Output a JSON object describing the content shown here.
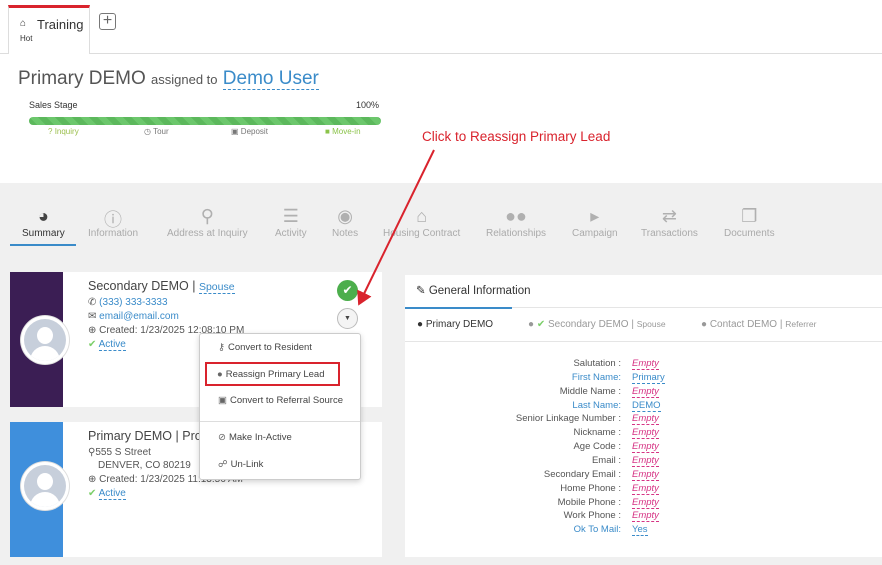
{
  "tabs": {
    "active": {
      "title": "Training",
      "subtitle": "Hot"
    },
    "add_label": "+"
  },
  "header": {
    "record_name": "Primary DEMO",
    "assigned_to_label": "assigned to",
    "assigned_user": "Demo User"
  },
  "sales_stage": {
    "label": "Sales Stage",
    "percent_label": "100%",
    "progress": 1.0,
    "stages": [
      "Inquiry",
      "Tour",
      "Deposit",
      "Move-in"
    ]
  },
  "annotation": {
    "text": "Click to Reassign Primary Lead",
    "color": "#d9232d"
  },
  "nav": {
    "items": [
      {
        "label": "Summary",
        "icon": "dashboard-icon"
      },
      {
        "label": "Information",
        "icon": "info-icon"
      },
      {
        "label": "Address at Inquiry",
        "icon": "map-marker-icon"
      },
      {
        "label": "Activity",
        "icon": "list-icon"
      },
      {
        "label": "Notes",
        "icon": "comments-icon"
      },
      {
        "label": "Housing Contract",
        "icon": "home-icon"
      },
      {
        "label": "Relationships",
        "icon": "users-icon"
      },
      {
        "label": "Campaign",
        "icon": "bullhorn-icon"
      },
      {
        "label": "Transactions",
        "icon": "exchange-icon"
      },
      {
        "label": "Documents",
        "icon": "files-icon"
      }
    ]
  },
  "contacts": [
    {
      "name": "Secondary DEMO",
      "separator": "|",
      "relationship": "Spouse",
      "phone": "(333) 333-3333",
      "email": "email@email.com",
      "created": "Created: 1/23/2025 12:08:10 PM",
      "status": "Active",
      "bar_color": "#3b1e54"
    },
    {
      "name": "Primary DEMO",
      "separator": "|",
      "relationship_partial": "Pro",
      "address_line1": "555 S Street",
      "address_line2": "DENVER, CO 80219",
      "created": "Created: 1/23/2025 11:13:56 AM",
      "status": "Active",
      "bar_color": "#3f8fdc"
    }
  ],
  "dropdown": {
    "items": [
      {
        "label": "Convert to Resident",
        "icon": "key-icon"
      },
      {
        "label": "Reassign Primary Lead",
        "icon": "user-icon"
      },
      {
        "label": "Convert to Referral Source",
        "icon": "id-card-icon"
      },
      {
        "label": "Make In-Active",
        "icon": "ban-icon"
      },
      {
        "label": "Un-Link",
        "icon": "unlink-icon"
      }
    ]
  },
  "general_info": {
    "title": "General Information",
    "tabs": [
      {
        "label": "Primary DEMO",
        "sub": ""
      },
      {
        "label": "Secondary DEMO",
        "sub": "Spouse"
      },
      {
        "label": "Contact DEMO",
        "sub": "Referrer"
      }
    ],
    "tab_separator": "|",
    "fields": [
      {
        "label": "Salutation :",
        "value": "Empty",
        "label_link": false,
        "empty": true
      },
      {
        "label": "First Name:",
        "value": "Primary",
        "label_link": true,
        "empty": false
      },
      {
        "label": "Middle Name :",
        "value": "Empty",
        "label_link": false,
        "empty": true
      },
      {
        "label": "Last Name:",
        "value": "DEMO",
        "label_link": true,
        "empty": false
      },
      {
        "label": "Senior Linkage Number :",
        "value": "Empty",
        "label_link": false,
        "empty": true
      },
      {
        "label": "Nickname :",
        "value": "Empty",
        "label_link": false,
        "empty": true
      },
      {
        "label": "Age Code :",
        "value": "Empty",
        "label_link": false,
        "empty": true
      },
      {
        "label": "Email :",
        "value": "Empty",
        "label_link": false,
        "empty": true
      },
      {
        "label": "Secondary Email :",
        "value": "Empty",
        "label_link": false,
        "empty": true
      },
      {
        "label": "Home Phone :",
        "value": "Empty",
        "label_link": false,
        "empty": true
      },
      {
        "label": "Mobile Phone :",
        "value": "Empty",
        "label_link": false,
        "empty": true
      },
      {
        "label": "Work Phone :",
        "value": "Empty",
        "label_link": false,
        "empty": true
      },
      {
        "label": "Ok To Mail:",
        "value": "Yes",
        "label_link": true,
        "empty": false
      }
    ]
  }
}
